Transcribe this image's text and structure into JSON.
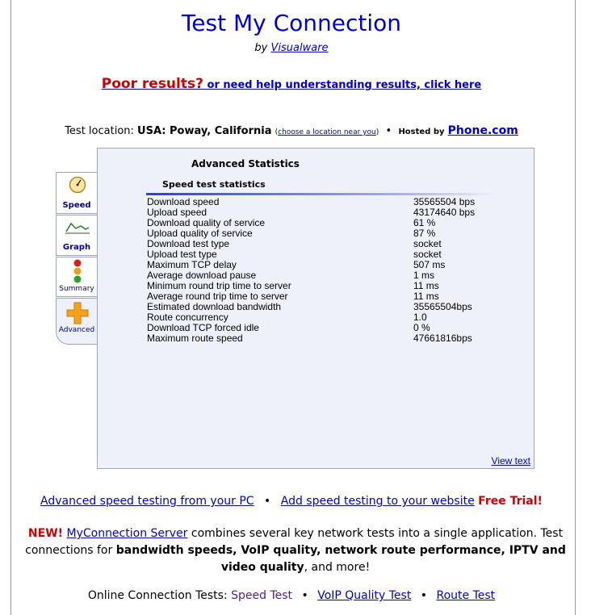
{
  "header": {
    "title": "Test My Connection",
    "by_prefix": "by",
    "by_link": "Visualware"
  },
  "help": {
    "poor": "Poor results?",
    "rest": " or need help understanding results, click here"
  },
  "location": {
    "prefix": "Test location:",
    "value": "USA: Poway, California",
    "choose_link": "choose a location near you",
    "hosted_by": "Hosted by",
    "host_link": "Phone.com"
  },
  "tabs": [
    {
      "label": "Speed",
      "icon": "speedometer-icon"
    },
    {
      "label": "Graph",
      "icon": "line-graph-icon"
    },
    {
      "label": "Summary",
      "icon": "traffic-light-icon"
    },
    {
      "label": "Advanced",
      "icon": "orange-plus-icon",
      "active": true
    }
  ],
  "panel": {
    "title": "Advanced Statistics",
    "subtitle": "Speed test statistics",
    "stats": [
      {
        "label": "Download speed",
        "value": "35565504 bps"
      },
      {
        "label": "Upload speed",
        "value": "43174640 bps"
      },
      {
        "label": "Download quality of service",
        "value": "61 %"
      },
      {
        "label": "Upload quality of service",
        "value": "87 %"
      },
      {
        "label": "Download test type",
        "value": "socket"
      },
      {
        "label": "Upload test type",
        "value": "socket"
      },
      {
        "label": "Maximum TCP delay",
        "value": "507 ms"
      },
      {
        "label": "Average download pause",
        "value": "1 ms"
      },
      {
        "label": "Minimum round trip time to server",
        "value": "11 ms"
      },
      {
        "label": "Average round trip time to server",
        "value": "11 ms"
      },
      {
        "label": "Estimated download bandwidth",
        "value": "35565504bps"
      },
      {
        "label": "Route concurrency",
        "value": "1.0"
      },
      {
        "label": "Download TCP forced idle",
        "value": "0 %"
      },
      {
        "label": "Maximum route speed",
        "value": "47661816bps"
      }
    ],
    "view_text": "View text"
  },
  "links": {
    "advanced_pc": "Advanced speed testing from your PC",
    "bullet": "•",
    "add_speed": "Add speed testing to your website",
    "free_trial": "Free Trial!"
  },
  "promo": {
    "new": "NEW!",
    "server_link": "MyConnection Server",
    "text1": " combines several key network tests into a single application. Test connections for ",
    "bold": "bandwidth speeds, VoIP quality, network route performance, IPTV and video quality",
    "text2": ", and more!"
  },
  "online": {
    "prefix": "Online Connection Tests:",
    "tests": [
      "Speed Test",
      "VoIP Quality Test",
      "Route Test"
    ]
  },
  "colors": {
    "link": "#0000cc",
    "alert_red": "#cc0000",
    "panel_bg": "#eef1f9",
    "visited": "#551a8b"
  }
}
